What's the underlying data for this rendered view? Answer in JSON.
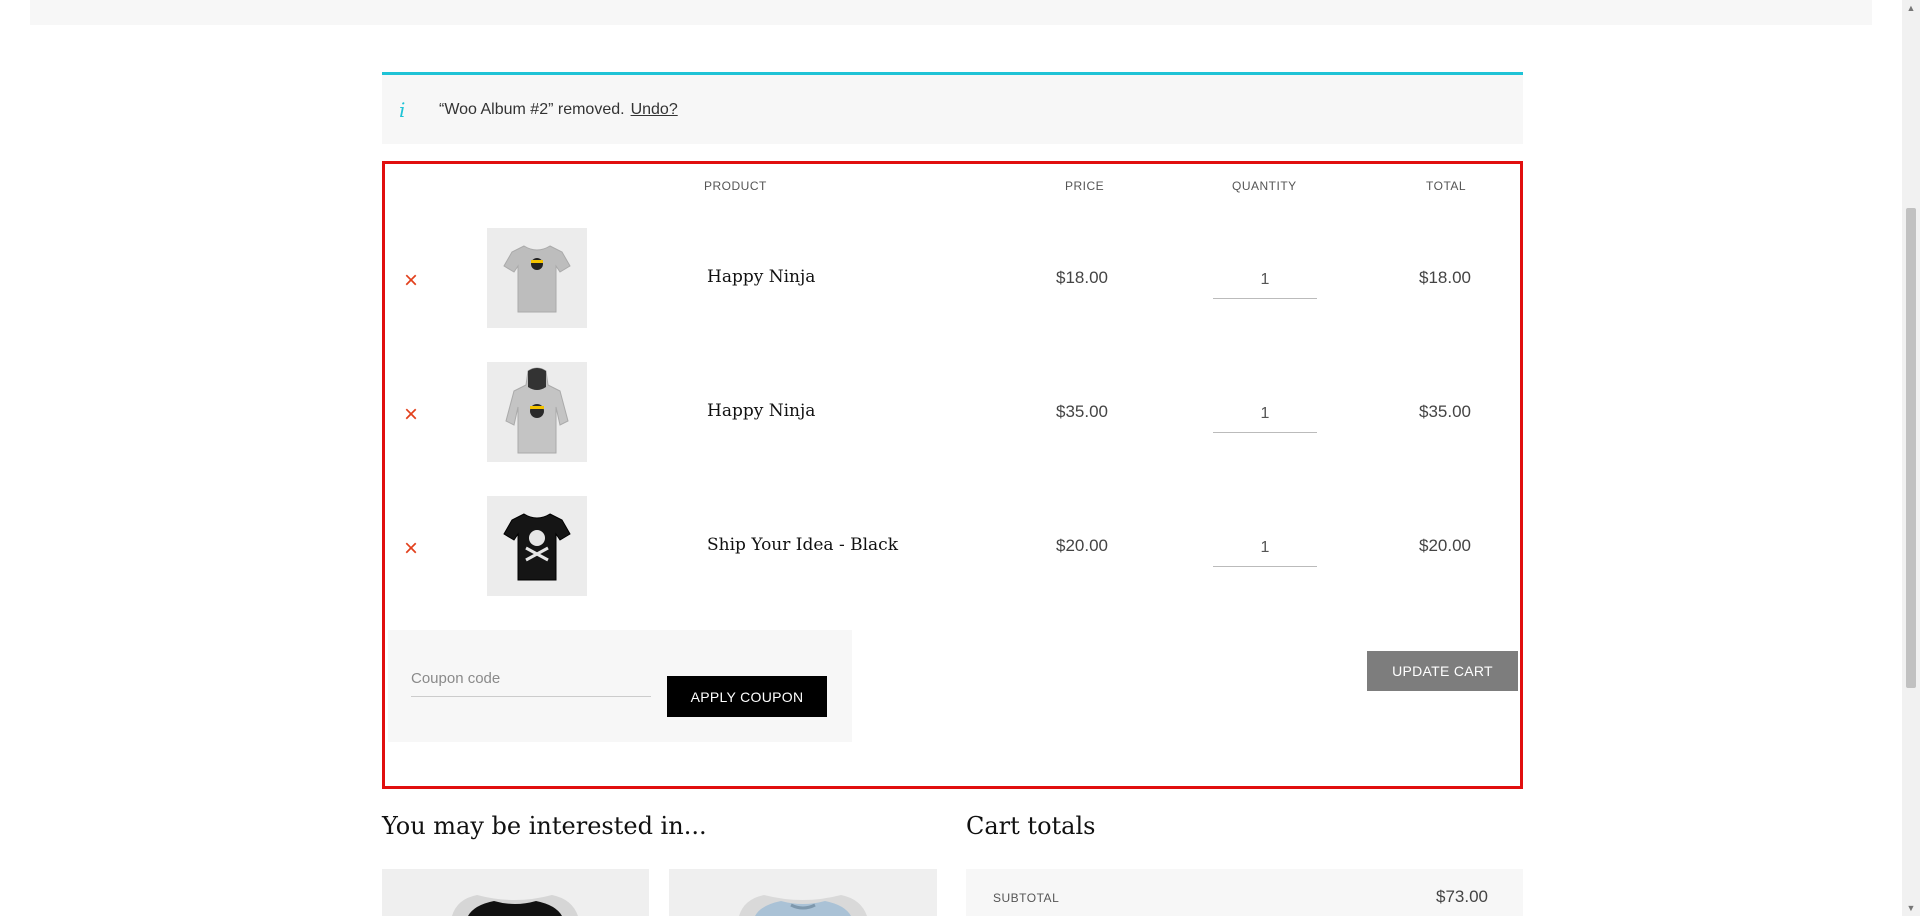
{
  "notice": {
    "message": "“Woo Album #2” removed.",
    "undo_label": "Undo?"
  },
  "table": {
    "headers": {
      "product": "PRODUCT",
      "price": "PRICE",
      "quantity": "QUANTITY",
      "total": "TOTAL"
    },
    "rows": [
      {
        "name": "Happy Ninja",
        "price": "$18.00",
        "quantity": "1",
        "total": "$18.00",
        "image_icon": "tshirt-grey-icon"
      },
      {
        "name": "Happy Ninja",
        "price": "$35.00",
        "quantity": "1",
        "total": "$35.00",
        "image_icon": "hoodie-grey-icon"
      },
      {
        "name": "Ship Your Idea - Black",
        "price": "$20.00",
        "quantity": "1",
        "total": "$20.00",
        "image_icon": "tshirt-black-icon"
      }
    ],
    "remove_symbol": "×"
  },
  "coupon": {
    "placeholder": "Coupon code",
    "apply_label": "APPLY COUPON"
  },
  "update_label": "UPDATE CART",
  "related": {
    "title": "You may be interested in..."
  },
  "cart_totals": {
    "title": "Cart totals",
    "subtotal_label": "SUBTOTAL",
    "subtotal_value": "$73.00"
  },
  "colors": {
    "notice_accent": "#1fc3d6",
    "highlight_border": "#e10f0f",
    "remove": "#e2401c",
    "update_button": "#7d7d7d"
  }
}
